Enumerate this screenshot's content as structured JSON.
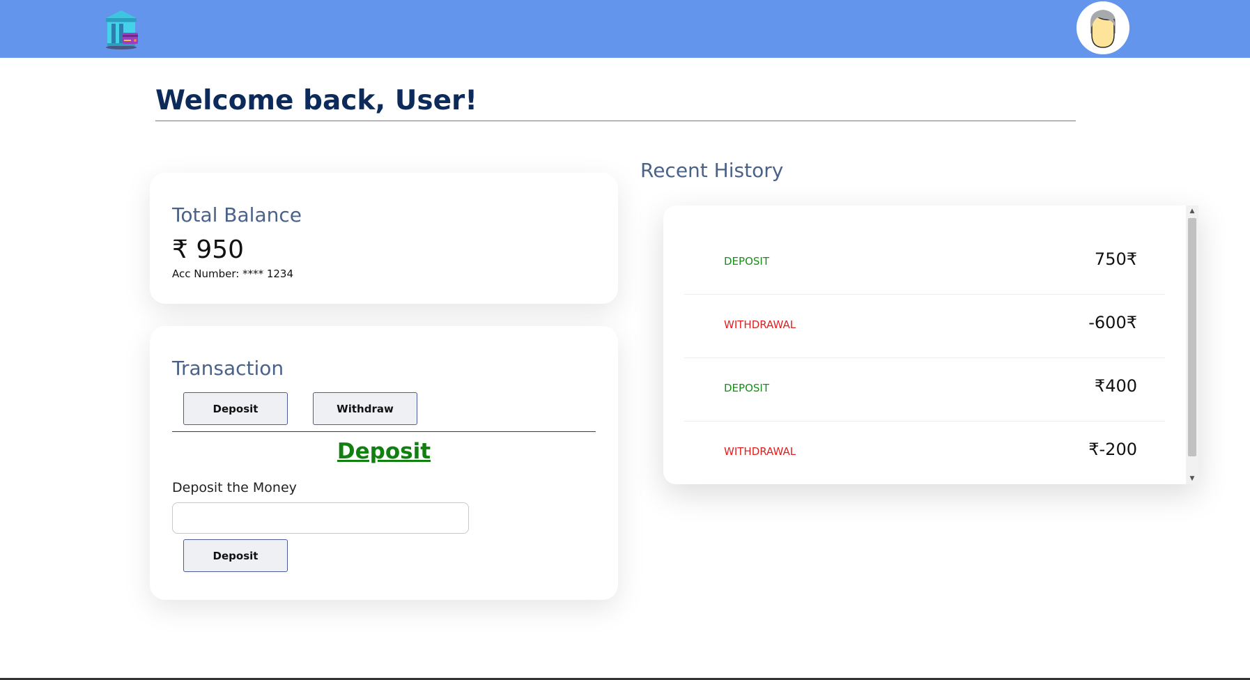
{
  "header": {
    "logo_icon": "bank-card-icon",
    "avatar_icon": "user-avatar-icon"
  },
  "welcome": {
    "title": "Welcome back, User!"
  },
  "balance": {
    "title": "Total Balance",
    "amount": "₹ 950",
    "account": "Acc Number: **** 1234"
  },
  "transaction": {
    "title": "Transaction",
    "tabs": {
      "deposit": "Deposit",
      "withdraw": "Withdraw"
    },
    "heading": "Deposit",
    "input_label": "Deposit the Money",
    "input_value": "",
    "submit_label": "Deposit"
  },
  "history": {
    "title": "Recent History",
    "items": [
      {
        "type": "DEPOSIT",
        "amount": "750₹"
      },
      {
        "type": "WITHDRAWAL",
        "amount": "-600₹"
      },
      {
        "type": "DEPOSIT",
        "amount": "₹400"
      },
      {
        "type": "WITHDRAWAL",
        "amount": "₹-200"
      }
    ]
  },
  "colors": {
    "navbar": "#6495ed",
    "deposit": "#1a8a1a",
    "withdrawal": "#e02020",
    "heading": "#0d2b5a",
    "card_title": "#4a6288"
  }
}
